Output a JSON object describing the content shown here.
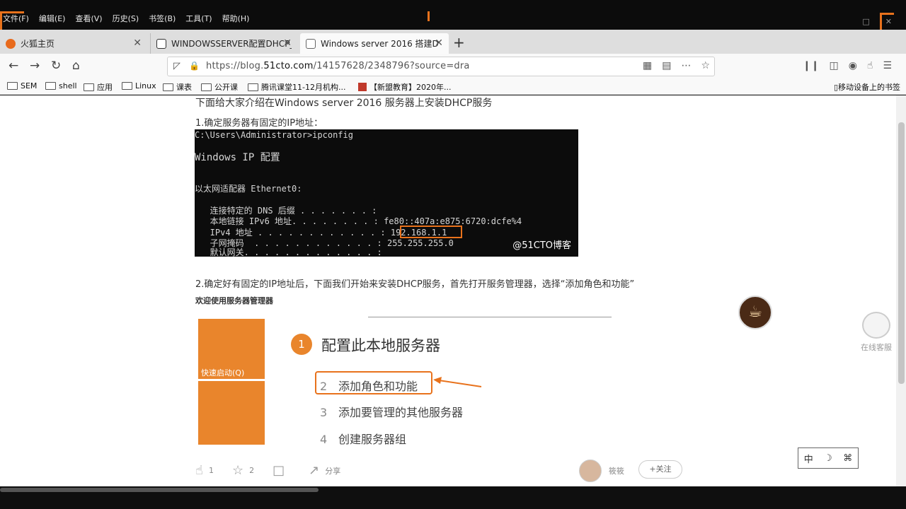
{
  "menu": [
    "文件(F)",
    "编辑(E)",
    "查看(V)",
    "历史(S)",
    "书签(B)",
    "工具(T)",
    "帮助(H)"
  ],
  "tabs": [
    {
      "label": "火狐主页"
    },
    {
      "label": "WINDOWSSERVER配置DHCP_自"
    },
    {
      "label": "Windows server 2016 搭建D"
    }
  ],
  "new_tab": "+",
  "url": {
    "prefix": "https://blog.",
    "domain": "51cto.com",
    "rest": "/14157628/2348796?source=dra"
  },
  "bookmarks": [
    "SEM",
    "shell",
    "应用",
    "Linux",
    "课表",
    "公开课",
    "腾讯课堂11-12月机构...",
    "【新盟教育】2020年..."
  ],
  "bookmarks_mobile": "移动设备上的书签",
  "article": {
    "intro": "下面给大家介绍在Windows server 2016 服务器上安装DHCP服务",
    "step1": "1.确定服务器有固定的IP地址：",
    "cmd_lines": [
      "C:\\Users\\Administrator>ipconfig",
      "Windows IP 配置",
      "以太网适配器 Ethernet0:",
      "   连接特定的 DNS 后缀 . . . . . . . :",
      "   本地链接 IPv6 地址. . . . . . . . : fe80::407a:e875:6720:dcfe%4",
      "   IPv4 地址 . . . . . . . . . . . . : 192.168.1.1",
      "   子网掩码  . . . . . . . . . . . . : 255.255.255.0",
      "   默认网关. . . . . . . . . . . . . :"
    ],
    "cmd_watermark": "@51CTO博客",
    "step2": "2.确定好有固定的IP地址后，下面我们开始来安装DHCP服务，首先打开服务管理器，选择“添加角色和功能”",
    "welcome": "欢迎使用服务器管理器",
    "sm": {
      "quick_start": "快速启动(Q)",
      "circle_num": "1",
      "title": "配置此本地服务器",
      "items": [
        {
          "num": "2",
          "label": "添加角色和功能"
        },
        {
          "num": "3",
          "label": "添加要管理的其他服务器"
        },
        {
          "num": "4",
          "label": "创建服务器组"
        }
      ]
    }
  },
  "actions": {
    "likes": "1",
    "stars": "2",
    "share": "分享"
  },
  "author": {
    "name": "筱筱",
    "follow": "+关注"
  },
  "mascot_label": "在线客服",
  "ime": [
    "中",
    "☽",
    "⌘"
  ],
  "colors": {
    "accent": "#e8721c",
    "sm_orange": "#e9852c"
  }
}
